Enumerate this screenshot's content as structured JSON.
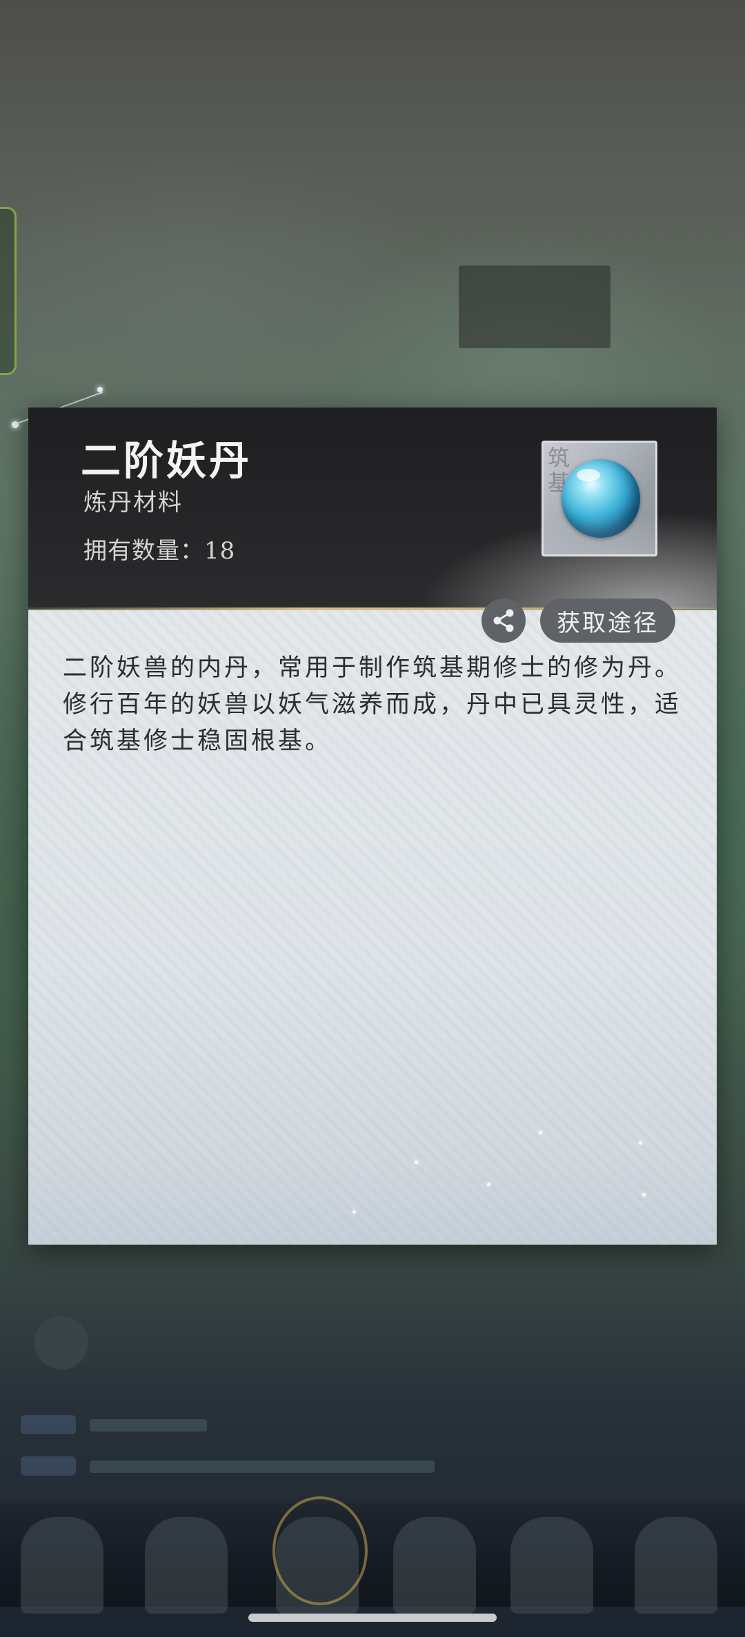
{
  "item": {
    "name": "二阶妖丹",
    "category": "炼丹材料",
    "count_label": "拥有数量：18",
    "count": 18,
    "icon": "blue-pill-orb",
    "rank_stamp": "筑基",
    "description": "二阶妖兽的内丹，常用于制作筑基期修士的修为丹。修行百年的妖兽以妖气滋养而成，丹中已具灵性，适合筑基修士稳固根基。"
  },
  "actions": {
    "share_icon": "share-icon",
    "acquire_label": "获取途径"
  },
  "colors": {
    "header_bg": "#262628",
    "body_bg": "#e0e5e9",
    "button_bg": "#5f6367",
    "accent_gold": "#d9c08a",
    "orb_blue": "#3eb2d8"
  }
}
